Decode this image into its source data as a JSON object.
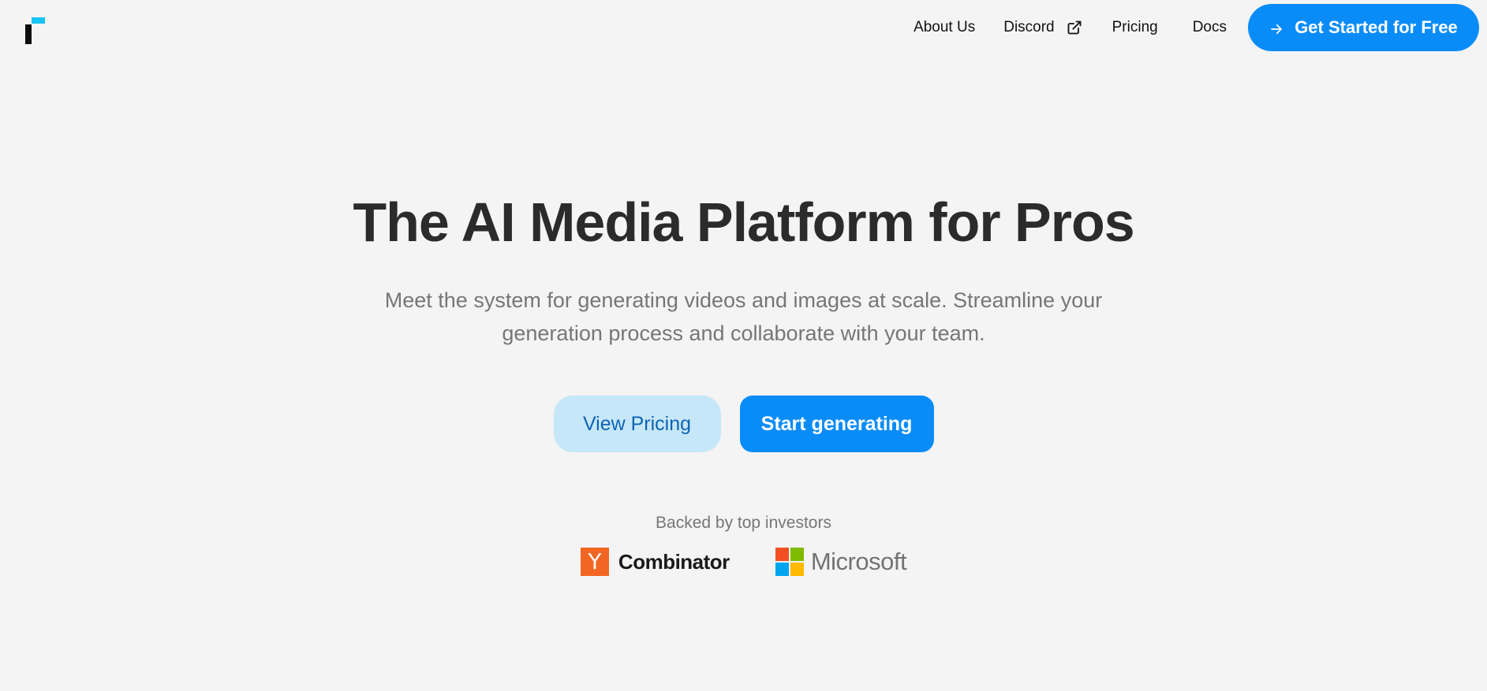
{
  "header": {
    "logo_icon": "brand-logo-icon",
    "nav": [
      {
        "label": "About Us"
      },
      {
        "label": "Discord",
        "icon": "external-link-icon"
      },
      {
        "label": "Pricing"
      },
      {
        "label": "Docs"
      }
    ],
    "cta_label": "Get Started for Free",
    "cta_icon": "arrow-right-icon"
  },
  "hero": {
    "title": "The AI Media Platform for Pros",
    "subtitle": "Meet the system for generating videos and images at scale. Streamline your generation process and collaborate with your team.",
    "secondary_button": "View Pricing",
    "primary_button": "Start generating"
  },
  "investors": {
    "label": "Backed by top investors",
    "yc": {
      "mark": "Y",
      "wordmark": "Combinator"
    },
    "microsoft": {
      "wordmark": "Microsoft"
    }
  },
  "colors": {
    "background": "#f4f4f4",
    "accent": "#0a8cf8",
    "accent_light": "#c6e7f8",
    "logo_blue": "#16c4f2",
    "yc_orange": "#f26522",
    "ms_red": "#f25022",
    "ms_green": "#7fba00",
    "ms_blue": "#00a4ef",
    "ms_yellow": "#ffb900"
  }
}
